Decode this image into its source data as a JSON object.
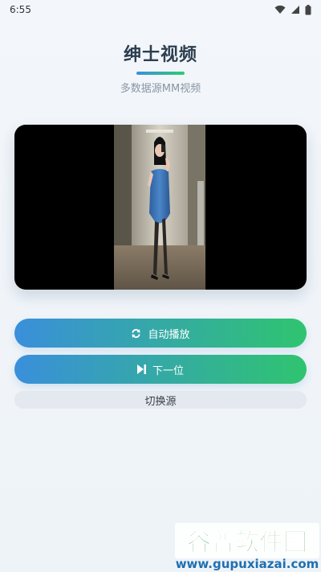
{
  "status_bar": {
    "time": "6:55"
  },
  "header": {
    "title": "绅士视频",
    "subtitle": "多数据源MM视频"
  },
  "buttons": {
    "autoplay": "自动播放",
    "next": "下一位",
    "switch_source": "切换源"
  },
  "watermark": {
    "brand": "谷普软件园",
    "url": "www.gupuxiazai.com"
  },
  "colors": {
    "accent_blue": "#3a8fdb",
    "accent_green": "#2fc46f",
    "title": "#2c3e50"
  }
}
